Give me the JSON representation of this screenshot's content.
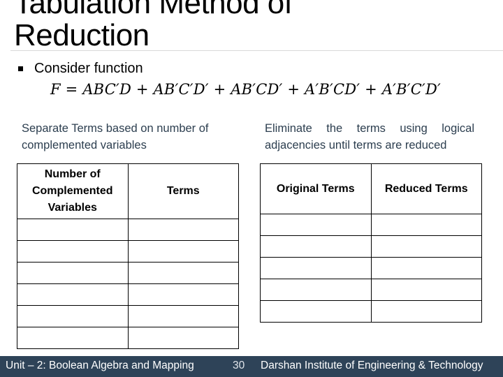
{
  "slide": {
    "title": "Tabulation Method of Reduction",
    "bullet": "Consider function",
    "equation": "F = ABC′D + AB′C′D′ + AB′CD′ + A′B′CD′ + A′B′C′D′"
  },
  "left_panel": {
    "caption": "Separate Terms based on number of complemented variables",
    "columns": [
      "Number of Complemented Variables",
      "Terms"
    ],
    "rows": [
      [
        "",
        ""
      ],
      [
        "",
        ""
      ],
      [
        "",
        ""
      ],
      [
        "",
        ""
      ],
      [
        "",
        ""
      ],
      [
        "",
        ""
      ]
    ]
  },
  "right_panel": {
    "caption": "Eliminate the terms using logical adjacencies until terms are reduced",
    "columns": [
      "Original Terms",
      "Reduced Terms"
    ],
    "rows": [
      [
        "",
        ""
      ],
      [
        "",
        ""
      ],
      [
        "",
        ""
      ],
      [
        "",
        ""
      ],
      [
        "",
        ""
      ]
    ]
  },
  "footer": {
    "unit": "Unit – 2: Boolean Algebra and Mapping",
    "page_number": "30",
    "institute": "Darshan Institute of Engineering & Technology"
  }
}
